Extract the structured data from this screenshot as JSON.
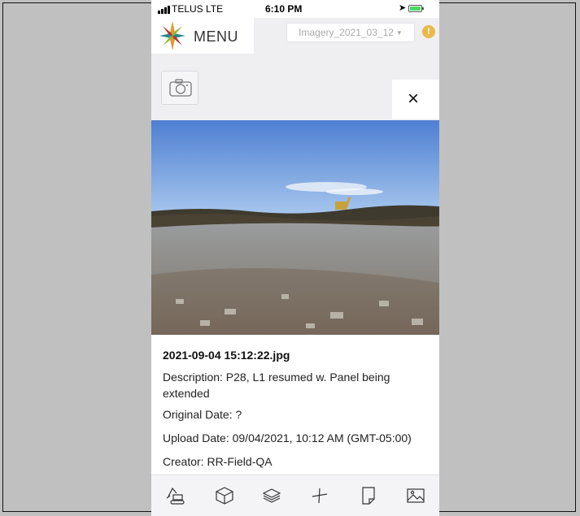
{
  "status_bar": {
    "carrier": "TELUS  LTE",
    "time": "6:10 PM"
  },
  "header": {
    "menu_label": "MENU",
    "imagery_selected": "Imagery_2021_03_12",
    "alert_symbol": "!"
  },
  "viewer": {
    "close_symbol": "×",
    "filename": "2021-09-04 15:12:22.jpg",
    "description": "Description: P28, L1 resumed w. Panel being extended",
    "original_date": "Original Date: ?",
    "upload_date": "Upload Date: 09/04/2021, 10:12 AM (GMT-05:00)",
    "creator": "Creator: RR-Field-QA"
  },
  "toolbar": {
    "icons": [
      "excavator-icon",
      "box-icon",
      "layers-icon",
      "measure-icon",
      "document-icon",
      "image-icon"
    ]
  },
  "colors": {
    "accent_alert": "#e8b84a",
    "background": "#efeff2"
  }
}
